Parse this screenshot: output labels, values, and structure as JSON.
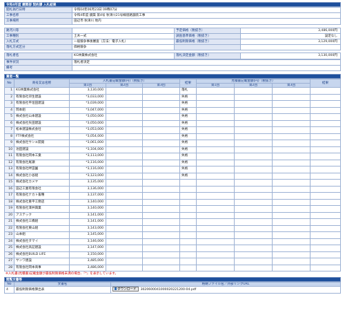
{
  "title": "令和4年度 鏡築部 契約課 入札結果",
  "info": {
    "rows1": [
      {
        "label": "開札執行日時",
        "value": "令和04年06月23日 09時07分"
      },
      {
        "label": "工事名称",
        "value": "令和4年度 鏡築 第4号 秋津川21号線道路舗装工事"
      },
      {
        "label": "工事場所",
        "value": "田辺市 秋津川 地内"
      }
    ],
    "rows2": [
      {
        "l1": "路河川等",
        "v1": "",
        "l2": "予定価格（税抜き）",
        "v2": "3,486,000円"
      },
      {
        "l1": "工事種別",
        "v1": "土木一式",
        "l2": "調査基準価格（税抜き）",
        "v2": "設定なし"
      },
      {
        "l1": "入札方式",
        "v1": "一般競争事後審査（方法：電子入札）",
        "l2": "最低制限価格（税抜き）",
        "v2": "3,129,000円"
      },
      {
        "l1": "落札方式区分",
        "v1": "価格競争",
        "l2": "",
        "v2": ""
      }
    ],
    "row3": {
      "l1": "落札者名",
      "v1": "KG林業株式会社",
      "l2": "落札決定金額（税抜き）",
      "v2": "3,130,000円"
    },
    "rows4": [
      {
        "label": "事件状況",
        "value": "落札者決定"
      },
      {
        "label": "備考",
        "value": ""
      }
    ]
  },
  "list": {
    "section_title": "業者一覧",
    "h_no": "No",
    "h_name": "商号又は名称",
    "h_bid": "入札書記載金額(円)（税抜き）",
    "h_result": "結果",
    "h_rebid": "見積書記載金額(円)（税抜き）",
    "h_result2": "結果",
    "h_r1": "第1回",
    "h_r2": "第2回",
    "h_r3": "第3回",
    "h_e1": "第1回",
    "h_e2": "第2回",
    "h_e3": "第3回",
    "rows": [
      {
        "no": "1",
        "name": "KG林業株式会社",
        "amt": "3,130,000",
        "res": "落札"
      },
      {
        "no": "2",
        "name": "有限会社卯生建設",
        "amt": "*3,033,000",
        "res": "失格"
      },
      {
        "no": "3",
        "name": "有限会社平垣田建設",
        "amt": "*3,039,000",
        "res": "失格"
      },
      {
        "no": "4",
        "name": "岡本組",
        "amt": "*3,047,000",
        "res": "失格"
      },
      {
        "no": "5",
        "name": "株式会社山本建設",
        "amt": "*3,050,000",
        "res": "失格"
      },
      {
        "no": "6",
        "name": "株式会社矢田建設",
        "amt": "*3,050,000",
        "res": "失格"
      },
      {
        "no": "7",
        "name": "松本建設株式会社",
        "amt": "*3,053,000",
        "res": "失格"
      },
      {
        "no": "8",
        "name": "FTF株式会社",
        "amt": "*3,054,000",
        "res": "失格"
      },
      {
        "no": "9",
        "name": "株式会社サンエ開発",
        "amt": "*3,061,000",
        "res": "失格"
      },
      {
        "no": "10",
        "name": "池田建設",
        "amt": "*3,104,000",
        "res": "失格"
      },
      {
        "no": "11",
        "name": "有限会社岡本工業",
        "amt": "*3,113,000",
        "res": "失格"
      },
      {
        "no": "12",
        "name": "有限会社尾瀬",
        "amt": "*3,116,000",
        "res": "失格"
      },
      {
        "no": "13",
        "name": "有限会社畔田園",
        "amt": "*3,116,000",
        "res": "失格"
      },
      {
        "no": "14",
        "name": "株式会社小谷組",
        "amt": "*3,123,000",
        "res": "失格"
      },
      {
        "no": "15",
        "name": "株式会社カメヤ",
        "amt": "3,135,000",
        "res": ""
      },
      {
        "no": "16",
        "name": "田辺工業有限会社",
        "amt": "3,136,000",
        "res": ""
      },
      {
        "no": "17",
        "name": "有限会社ナカト畜種",
        "amt": "3,137,000",
        "res": ""
      },
      {
        "no": "18",
        "name": "株式会社重平工務店",
        "amt": "3,140,000",
        "res": ""
      },
      {
        "no": "19",
        "name": "有限会社澤井興業",
        "amt": "3,140,000",
        "res": ""
      },
      {
        "no": "20",
        "name": "アステック",
        "amt": "3,141,000",
        "res": ""
      },
      {
        "no": "21",
        "name": "株式会社三橋組",
        "amt": "3,141,000",
        "res": ""
      },
      {
        "no": "22",
        "name": "有限会社東山組",
        "amt": "3,143,000",
        "res": ""
      },
      {
        "no": "23",
        "name": "山本組",
        "amt": "3,145,000",
        "res": ""
      },
      {
        "no": "24",
        "name": "株式会社タマイ",
        "amt": "3,146,000",
        "res": ""
      },
      {
        "no": "25",
        "name": "株式会社高記建設",
        "amt": "3,147,000",
        "res": ""
      },
      {
        "no": "26",
        "name": "株式会社BUILD LIFE",
        "amt": "3,150,000",
        "res": ""
      },
      {
        "no": "27",
        "name": "サンワ建設",
        "amt": "3,485,000",
        "res": ""
      },
      {
        "no": "28",
        "name": "有限会社岡本商事",
        "amt": "3,486,000",
        "res": ""
      }
    ],
    "note": "※入札書(見積書)記載金額が最低制限価格未満の場合、『*』を表示しています。"
  },
  "docs": {
    "section_title": "閲覧文書等",
    "h_no": "No",
    "h_name": "文書名",
    "h_file": "格納ファイル名／外部リンクURL",
    "rows": [
      {
        "no": "4",
        "name": "最低制限価格算出表",
        "btn": "ダウンロード",
        "file": "3020600041000020221200-04.pdf"
      }
    ]
  },
  "colors": {
    "header_bar": "#1d4f9c",
    "label_bg": "#dfe6f4",
    "note": "#cc0000"
  }
}
